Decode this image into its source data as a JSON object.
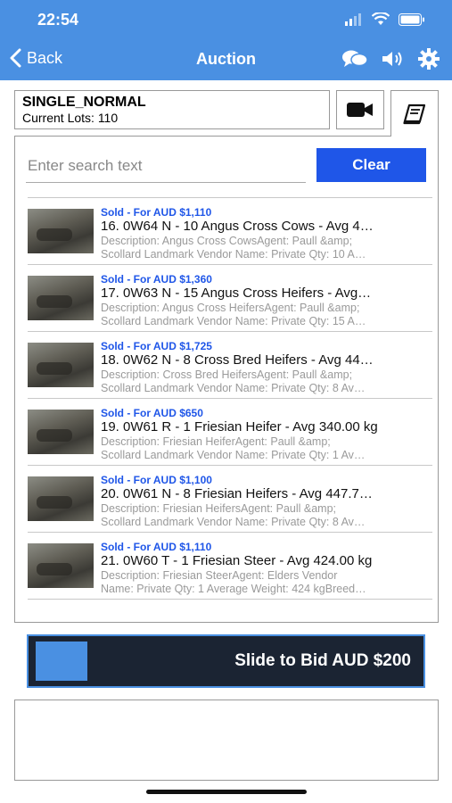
{
  "status_bar": {
    "time": "22:54"
  },
  "nav": {
    "back_label": "Back",
    "title": "Auction"
  },
  "session": {
    "name": "SINGLE_NORMAL",
    "current_lots": "Current Lots: 110"
  },
  "search": {
    "placeholder": "Enter search text",
    "value": "",
    "clear_label": "Clear"
  },
  "lots": [
    {
      "status": "Sold - For AUD $1,110",
      "title": "16. 0W64 N - 10 Angus Cross Cows - Avg 4…",
      "desc1": "Description: Angus Cross CowsAgent: Paull &amp;",
      "desc2": "Scollard Landmark Vendor Name: Private Qty: 10 A…"
    },
    {
      "status": "Sold - For AUD $1,360",
      "title": "17. 0W63 N - 15 Angus Cross Heifers - Avg…",
      "desc1": "Description: Angus Cross HeifersAgent: Paull &amp;",
      "desc2": "Scollard Landmark Vendor Name: Private Qty: 15 A…"
    },
    {
      "status": "Sold - For AUD $1,725",
      "title": "18. 0W62 N - 8 Cross Bred Heifers - Avg 44…",
      "desc1": "Description: Cross Bred HeifersAgent: Paull &amp;",
      "desc2": "Scollard Landmark Vendor Name: Private Qty: 8 Av…"
    },
    {
      "status": "Sold - For AUD $650",
      "title": "19. 0W61 R - 1 Friesian Heifer - Avg 340.00 kg",
      "desc1": "Description: Friesian HeiferAgent: Paull &amp;",
      "desc2": "Scollard Landmark Vendor Name: Private Qty: 1 Av…"
    },
    {
      "status": "Sold - For AUD $1,100",
      "title": "20. 0W61 N - 8 Friesian Heifers - Avg 447.7…",
      "desc1": "Description: Friesian HeifersAgent: Paull &amp;",
      "desc2": "Scollard Landmark Vendor Name: Private Qty: 8 Av…"
    },
    {
      "status": "Sold - For AUD $1,110",
      "title": "21. 0W60 T - 1 Friesian Steer - Avg 424.00 kg",
      "desc1": "Description: Friesian SteerAgent: Elders Vendor",
      "desc2": "Name: Private Qty: 1 Average Weight: 424 kgBreed…"
    }
  ],
  "slider": {
    "label": "Slide to Bid AUD $200"
  },
  "colors": {
    "header": "#4a90e2",
    "accent": "#1f56e8",
    "slider_bg": "#1b2433"
  }
}
